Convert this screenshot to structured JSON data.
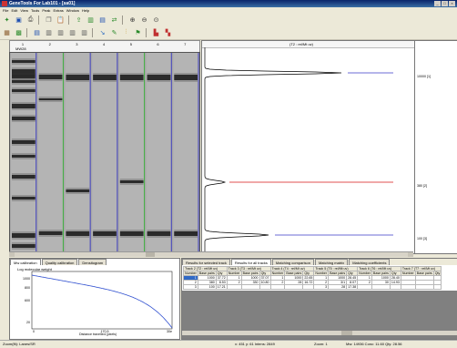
{
  "window": {
    "title": "GeneTools For Lab101 - [sa01]",
    "buttons": [
      "_",
      "□",
      "×"
    ]
  },
  "menu": [
    "File",
    "Edit",
    "View",
    "Tools",
    "Peak",
    "Extras",
    "Window",
    "Help"
  ],
  "toolbar1": [
    {
      "icon": "new-icon",
      "glyph": "✦",
      "color": "#2a8a2a"
    },
    {
      "icon": "save-icon",
      "glyph": "▣",
      "color": "#1c4db0"
    },
    {
      "icon": "print-icon",
      "glyph": "⎙",
      "color": "#333"
    },
    {
      "icon": "copy-icon",
      "glyph": "❐",
      "color": "#666"
    },
    {
      "icon": "paste-icon",
      "glyph": "📋",
      "color": "#666"
    },
    {
      "icon": "export-icon",
      "glyph": "⇪",
      "color": "#2a8a2a"
    },
    {
      "icon": "lane-icon",
      "glyph": "▥",
      "color": "#2a8a2a"
    },
    {
      "icon": "band-icon",
      "glyph": "▤",
      "color": "#1c4db0"
    },
    {
      "icon": "match-icon",
      "glyph": "⇄",
      "color": "#2a8a2a"
    },
    {
      "icon": "zoom-in-icon",
      "glyph": "⊕",
      "color": "#333"
    },
    {
      "icon": "zoom-out-icon",
      "glyph": "⊖",
      "color": "#333"
    },
    {
      "icon": "zoom-fit-icon",
      "glyph": "⊙",
      "color": "#333"
    }
  ],
  "toolbar2": [
    {
      "icon": "image-icon",
      "glyph": "▦",
      "color": "#8a5a2a"
    },
    {
      "icon": "grid-icon",
      "glyph": "▩",
      "color": "#2a8a2a"
    },
    {
      "icon": "bands-icon",
      "glyph": "▤",
      "color": "#1c4db0"
    },
    {
      "icon": "lanes-icon",
      "glyph": "▥",
      "color": "#555"
    },
    {
      "icon": "lanes2-icon",
      "glyph": "▥",
      "color": "#555"
    },
    {
      "icon": "lanes3-icon",
      "glyph": "▥",
      "color": "#555"
    },
    {
      "icon": "lanes4-icon",
      "glyph": "▥",
      "color": "#555"
    },
    {
      "icon": "arrow-icon",
      "glyph": "↘",
      "color": "#2a6ac0"
    },
    {
      "icon": "pen-icon",
      "glyph": "✎",
      "color": "#2a8a2a"
    },
    {
      "icon": "peaks-icon",
      "glyph": "⫶",
      "color": "#c08a10"
    },
    {
      "icon": "wand-icon",
      "glyph": "⚑",
      "color": "#2a8a2a"
    },
    {
      "icon": "report-icon",
      "glyph": "▙",
      "color": "#c03030"
    },
    {
      "icon": "layout-icon",
      "glyph": "▚",
      "color": "#c03030"
    }
  ],
  "lanes": {
    "numbers": [
      "1",
      "2",
      "3",
      "4",
      "5",
      "6",
      "7"
    ],
    "first_label": "MW28",
    "items": [
      {
        "bands": [
          [
            8,
            3
          ],
          [
            18,
            6
          ],
          [
            24,
            4
          ],
          [
            30,
            3
          ],
          [
            40,
            3
          ],
          [
            56,
            5
          ],
          [
            70,
            4
          ],
          [
            96,
            4
          ],
          [
            112,
            3
          ],
          [
            134,
            4
          ],
          [
            158,
            3
          ],
          [
            198,
            5
          ],
          [
            210,
            4
          ]
        ],
        "line": "#4040c0"
      },
      {
        "bands": [
          [
            24,
            5
          ],
          [
            50,
            2
          ],
          [
            196,
            4
          ]
        ],
        "line": "#40b040"
      },
      {
        "bands": [
          [
            24,
            6
          ],
          [
            150,
            3
          ],
          [
            196,
            5
          ]
        ],
        "line": "#4040c0"
      },
      {
        "bands": [
          [
            24,
            6
          ],
          [
            196,
            5
          ]
        ],
        "line": "#4040c0"
      },
      {
        "bands": [
          [
            24,
            6
          ],
          [
            140,
            3
          ],
          [
            196,
            5
          ]
        ],
        "line": "#40b040"
      },
      {
        "bands": [
          [
            24,
            6
          ],
          [
            196,
            5
          ]
        ],
        "line": "#4040c0"
      },
      {
        "bands": [
          [
            24,
            6
          ],
          [
            196,
            5
          ]
        ],
        "line": "#4040c0"
      }
    ]
  },
  "trace": {
    "header": "(T2 : rel/Mt uv)",
    "peaks": [
      {
        "label": "10000  [1]",
        "line": "#6b6bd6"
      },
      {
        "label": "380  [2]",
        "line": "#e05050"
      },
      {
        "label": "100  [3]",
        "line": "#6b6bd6"
      }
    ]
  },
  "bottom_left": {
    "tabs": [
      "Mw calibration",
      "Quality calibration",
      "Densitogram"
    ],
    "active_tab": 0,
    "ylabel": "Log molecular weight",
    "xlabel": "Distance travelled (pixels)",
    "yticks": [
      "1000",
      "800",
      "600",
      "20"
    ],
    "xticks": [
      "0",
      "170.5",
      "30e"
    ]
  },
  "bottom_right": {
    "tabs": [
      "Results for selected track",
      "Results for all tracks",
      "Matching comparison",
      "Matching matrix",
      "Matching coefficients"
    ],
    "active_tab": 1,
    "tracks": [
      {
        "name": "Track 2  (T2 : rel/Mt uv)"
      },
      {
        "name": "Track 3  (T3 : rel/Mt uv)"
      },
      {
        "name": "Track 4  (T4 : rel/Mt uv)"
      },
      {
        "name": "Track 5  (T5 : rel/Mt uv)"
      },
      {
        "name": "Track 6  (T6 : rel/Mt uv)"
      },
      {
        "name": "Track 7  (T7 : rel/Mt uv)"
      }
    ],
    "col_headers": [
      "Number",
      "Base pairs",
      "Qty"
    ],
    "rows": [
      [
        [
          "1",
          "1000",
          "37.72"
        ],
        [
          "1",
          "1000",
          "37.07"
        ],
        [
          "1",
          "1000",
          "22.65"
        ],
        [
          "1",
          "1000",
          "28.45"
        ],
        [
          "1",
          "1000",
          "28.40"
        ],
        [
          "",
          ""
        ]
      ],
      [
        [
          "2",
          "380",
          "8.53"
        ],
        [
          "2",
          "330",
          "10.80"
        ],
        [
          "2",
          "28",
          "16.72"
        ],
        [
          "2",
          "3/1",
          "8.07"
        ],
        [
          "2",
          "30",
          "14.93"
        ],
        [
          "",
          ""
        ]
      ],
      [
        [
          "3",
          "100",
          "17.21"
        ],
        [
          "",
          "",
          ""
        ],
        [
          "",
          "",
          ""
        ],
        [
          "3",
          "28",
          "17.38"
        ],
        [
          "",
          "",
          ""
        ],
        [
          "",
          ""
        ]
      ]
    ]
  },
  "status": {
    "left": "Zoom(fit): Lanes/SR",
    "mid": "x: 451  y: 61  Intens: 2849",
    "mid2": "Zoom: 1",
    "right": "Mw: 14936  Conc: 11.60  Qty: 28.56"
  }
}
